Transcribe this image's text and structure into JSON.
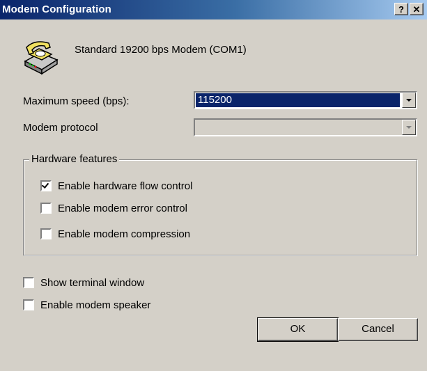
{
  "window": {
    "title": "Modem Configuration",
    "help_label": "?",
    "close_label": "✕"
  },
  "modem": {
    "name": "Standard 19200 bps Modem (COM1)",
    "icon": "phone-modem-icon"
  },
  "fields": {
    "max_speed_label": "Maximum speed (bps):",
    "max_speed_value": "115200",
    "protocol_label": "Modem protocol",
    "protocol_value": ""
  },
  "hardware": {
    "group_label": "Hardware features",
    "options": [
      {
        "label": "Enable hardware flow control",
        "checked": true
      },
      {
        "label": "Enable modem error control",
        "checked": false
      },
      {
        "label": "Enable modem compression",
        "checked": false
      }
    ]
  },
  "options": [
    {
      "label": "Show terminal window",
      "checked": false
    },
    {
      "label": "Enable modem speaker",
      "checked": false
    }
  ],
  "buttons": {
    "ok": "OK",
    "cancel": "Cancel"
  }
}
